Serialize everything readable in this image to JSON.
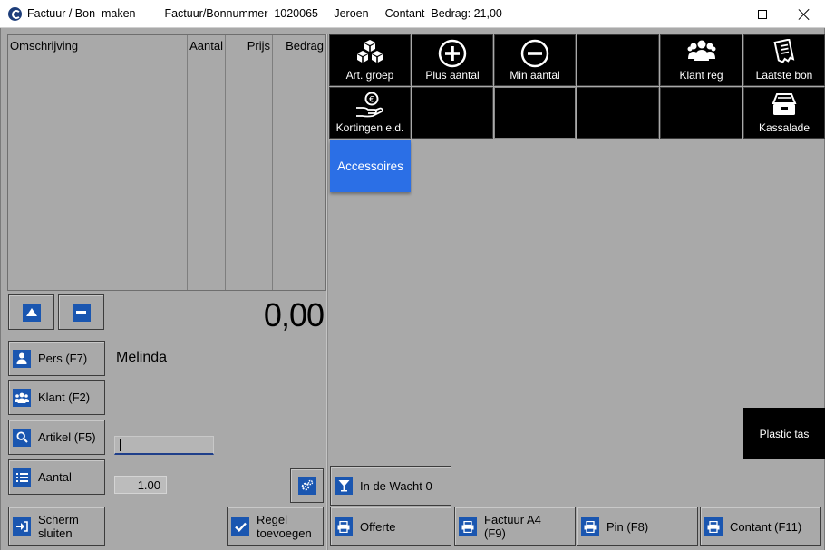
{
  "window": {
    "title": "Factuur / Bon  maken    -    Factuur/Bonnummer  1020065     Jeroen  -  Contant  Bedrag: 21,00"
  },
  "order_table": {
    "columns": [
      "Omschrijving",
      "Aantal",
      "Prijs",
      "Bedrag"
    ],
    "rows": []
  },
  "total": "0,00",
  "person": {
    "button_label": "Pers (F7)",
    "name": "Melinda"
  },
  "left_buttons": {
    "klant": "Klant (F2)",
    "artikel": "Artikel (F5)",
    "aantal": "Aantal",
    "scherm_sluiten": "Scherm sluiten",
    "regel_toevoegen": "Regel toevoegen"
  },
  "quantity_value": "1.00",
  "function_tiles": [
    {
      "label": "Art. groep",
      "icon": "cubes-icon"
    },
    {
      "label": "Plus aantal",
      "icon": "plus-circle-icon"
    },
    {
      "label": "Min aantal",
      "icon": "minus-circle-icon"
    },
    {
      "label": "",
      "icon": ""
    },
    {
      "label": "Klant reg",
      "icon": "users-icon"
    },
    {
      "label": "Laatste bon",
      "icon": "receipt-icon"
    },
    {
      "label": "Kortingen e.d.",
      "icon": "euro-hand-icon"
    },
    {
      "label": "",
      "icon": ""
    },
    {
      "label": "",
      "icon": ""
    },
    {
      "label": "",
      "icon": ""
    },
    {
      "label": "",
      "icon": ""
    },
    {
      "label": "Kassalade",
      "icon": "cash-drawer-icon"
    }
  ],
  "category": {
    "label": "Accessoires",
    "color": "#2b6fe6"
  },
  "quick_item": {
    "label": "Plastic tas"
  },
  "bottom_buttons": {
    "in_de_wacht": "In de Wacht 0",
    "offerte": "Offerte",
    "factuur_a4": "Factuur A4 (F9)",
    "pin": "Pin (F8)",
    "contant": "Contant (F11)"
  },
  "colors": {
    "accent_blue": "#1a56b0",
    "background": "#a9a9a9",
    "tile_black": "#000000"
  }
}
